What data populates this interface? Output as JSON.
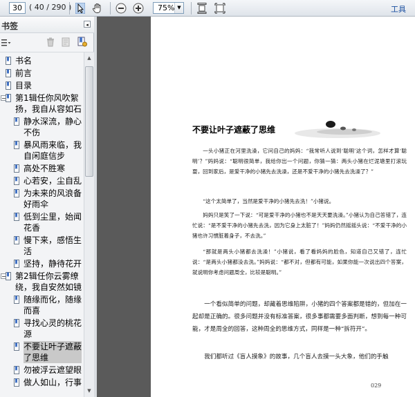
{
  "toolbar": {
    "page_number": "30",
    "page_count": "( 40 / 290 )",
    "zoom": "75%",
    "tools_label": "工具"
  },
  "sidebar": {
    "title": "书签",
    "items": [
      {
        "label": "书名"
      },
      {
        "label": "前言"
      },
      {
        "label": "目录"
      },
      {
        "label": "第1辑任你风吹絮扬，我自从容如石"
      },
      {
        "label": "静水深流，静心不伤"
      },
      {
        "label": "暴风雨来临，我自闲庭信步"
      },
      {
        "label": "高处不胜寒"
      },
      {
        "label": "心若安，尘自乱"
      },
      {
        "label": "为未来的风浪备好雨伞"
      },
      {
        "label": "低到尘里，始闻花香"
      },
      {
        "label": "慢下来，感悟生活"
      },
      {
        "label": "坚持，静待花开"
      },
      {
        "label": "第2辑任你云雾缭绕，我自安然如镜"
      },
      {
        "label": "随缘而化，随缘而喜"
      },
      {
        "label": "寻找心灵的桃花源"
      },
      {
        "label": "不要让叶子遮蔽了思维"
      },
      {
        "label": "勿被浮云遮望眼"
      },
      {
        "label": "做人如山，行事"
      }
    ]
  },
  "page": {
    "title": "不要让叶子遮蔽了思维",
    "paragraphs": [
      "一头小猪正在河里洗澡，它问自己的妈妈：“我常听人说到‘聪明’这个词，怎样才算‘聪明’？”妈妈说：“聪明很简单，我给你出一个问题，你猜一猜：两头小猪在烂泥塘里打滚玩耍，回到家后，是爱干净的小猪先去洗澡，还是不爱干净的小猪先去洗澡了？”",
      "“这个太简单了，当然是爱干净的小猪先去洗！”小猪说。",
      "妈妈只是笑了一下说：“可是爱干净的小猪也不是天天要洗澡。”小猪认为自己答错了，连忙说：“是不爱干净的小猪先去洗，因为它身上太脏了！”妈妈仍然摇摇头说：“不爱干净的小猪也许习惯脏着身子，不去洗。”",
      "“那就是两头小猪都去洗澡！”小猪说，看了看妈妈的脸色，知道自己又错了，连忙说：“是两头小猪都没去洗。”妈妈说：“都不对，但都有可能，如果你能一次说出四个答案，就说明你考虑问题周全，比较是聪明。”",
      "一个看似简单的问题，却藏着思维陷阱，小猪的四个答案都是错的，但加在一起却是正确的。很多问题并没有标准答案，很多事都需要多面判断，想到每一种可能，才是周全的回答，这种周全的思维方式，同样是一种“拆符开”。",
      "我们都听过《盲人摸象》的故事，几个盲人去摸一头大象，他们的手触"
    ],
    "page_number": "029"
  }
}
